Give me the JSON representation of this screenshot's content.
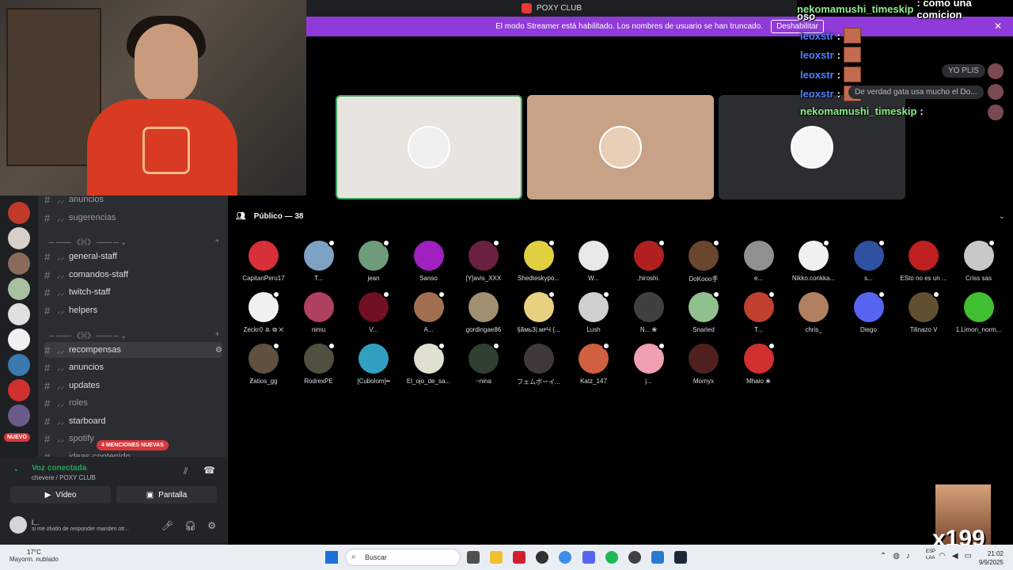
{
  "window": {
    "title": "POXY CLUB"
  },
  "banner": {
    "text": "El modo Streamer está habilitado. Los nombres de usuario se han truncado.",
    "button": "Deshabilitar"
  },
  "overlay_chat": [
    {
      "name": "nekomamushi_timeskip",
      "text": ": como una comicion"
    },
    {
      "name": "",
      "text": "oso"
    },
    {
      "name": "leoxstr",
      "text": ":"
    },
    {
      "name": "leoxstr",
      "text": ":"
    },
    {
      "name": "leoxstr",
      "text": ":"
    },
    {
      "name": "leoxstr",
      "text": ":"
    },
    {
      "name": "nekomamushi_timeskip",
      "text": ":"
    }
  ],
  "side_messages": {
    "m1": "YO PLIS",
    "m2": "De verdad gata usa mucho el Do..."
  },
  "channels": [
    {
      "label": "anuncios",
      "dim": true
    },
    {
      "label": "sugerencias",
      "dim": true
    },
    {
      "label": "general-staff"
    },
    {
      "label": "comandos-staff"
    },
    {
      "label": "twitch-staff"
    },
    {
      "label": "helpers"
    },
    {
      "label": "recompensas"
    },
    {
      "label": "anuncios"
    },
    {
      "label": "updates"
    },
    {
      "label": "roles",
      "dim": true
    },
    {
      "label": "starboard"
    },
    {
      "label": "spotify",
      "dim": true
    },
    {
      "label": "ideas-contenido",
      "dim": true
    }
  ],
  "rail": {
    "nuevo": "NUEVO"
  },
  "mentions_badge": "4 MENCIONES NUEVAS",
  "voice": {
    "status": "Voz conectada",
    "channel": "chevere / POXY CLUB",
    "video": "Vídeo",
    "screen": "Pantalla"
  },
  "user": {
    "name": "l...",
    "status": "si me olvido de responder manden otr..."
  },
  "audience": {
    "title": "Público — 38",
    "members": [
      "CapitanPeru17",
      "T...",
      "jean",
      "Sanso",
      "[Y]avis_XXX",
      "Shedteskypo...",
      "W...",
      ",hiroshi.",
      "DoKooo手",
      "e...",
      "Nikko.conkka...",
      "s...",
      "ESto no es un ...",
      "Criss sas",
      "Zeckr0 ꔛ ⧉ ✕",
      "nimu",
      "V...",
      "A...",
      "gordingae86",
      "§ãмьЗ|.ᴍᴘЧ {...",
      "Lush",
      "N... ❀",
      "Snarled",
      "T...",
      "chris_",
      "Diego",
      "Tilinazo V",
      "1.Limon_norm...",
      "Ƶatios_gg",
      "RodrexPE",
      "[Cubolom]━",
      "El_ojo_de_sa...",
      "~nina",
      "フェムボーイ...",
      "Katz_147",
      "j...",
      "Mornyx",
      "Mhaio ❀"
    ],
    "colors": [
      "#d8303a",
      "#7ea2c4",
      "#6e9c7a",
      "#a020c0",
      "#6a2040",
      "#e0d040",
      "#e8e8e8",
      "#b02020",
      "#6a4630",
      "#909090",
      "#f0f0f0",
      "#3050a0",
      "#c02020",
      "#c8c8c8",
      "#f0f0f0",
      "#b04060",
      "#701020",
      "#a07050",
      "#a09070",
      "#e8d080",
      "#d0d0d0",
      "#404040",
      "#90c090",
      "#c04030",
      "#b08060",
      "#5865f2",
      "#605030",
      "#40c030",
      "#605040",
      "#505040",
      "#30a0c0",
      "#e0e0d0",
      "#304030",
      "#403838",
      "#d06040",
      "#f0a0b0",
      "#502020",
      "#d03030"
    ]
  },
  "meme_overlay": {
    "count": "x199"
  },
  "taskbar": {
    "weather_temp": "17°C",
    "weather_desc": "Mayorm. nublado",
    "search": "Buscar",
    "lang1": "ESP",
    "lang2": "LAA",
    "time": "21:02",
    "date": "9/9/2025"
  }
}
